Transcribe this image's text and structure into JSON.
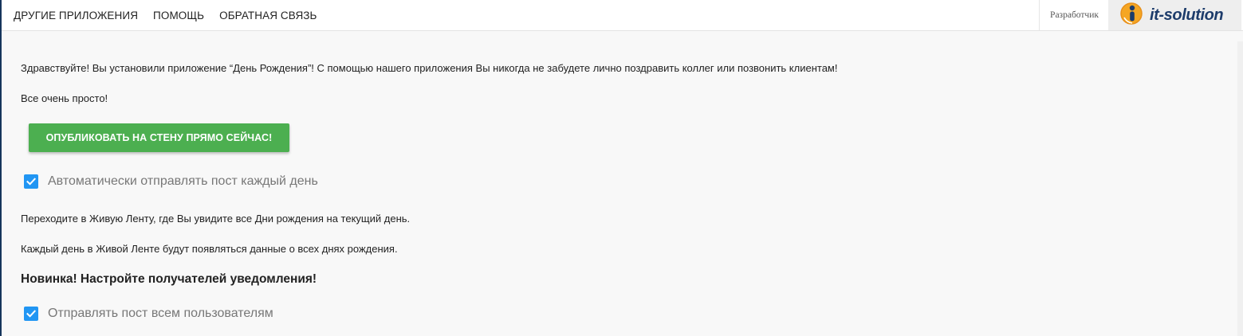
{
  "nav": {
    "items": [
      {
        "label": "ДРУГИЕ ПРИЛОЖЕНИЯ"
      },
      {
        "label": "ПОМОЩЬ"
      },
      {
        "label": "ОБРАТНАЯ СВЯЗЬ"
      }
    ]
  },
  "header": {
    "developer_label": "Разработчик",
    "brand_name": "it-solution",
    "brand_icon": "it-solution-logo-icon",
    "brand_color": "#1d3c6b",
    "logo_color": "#f5a623"
  },
  "main": {
    "intro_text": "Здравствуйте! Вы установили приложение “День Рождения”! С помощью нашего приложения Вы никогда не забудете лично поздравить коллег или позвонить клиентам!",
    "simple_text": "Все очень просто!",
    "publish_button": "ОПУБЛИКОВАТЬ НА СТЕНУ ПРЯМО СЕЙЧАС!",
    "auto_post": {
      "label": "Автоматически отправлять пост каждый день",
      "checked": true
    },
    "feed_text_1": "Переходите в Живую Ленту, где Вы увидите все Дни рождения на текущий день.",
    "feed_text_2": "Каждый день в Живой Ленте будут появляться данные о всех днях рождения.",
    "new_heading": "Новинка! Настройте получателей уведомления!",
    "send_all": {
      "label": "Отправлять пост всем пользователям",
      "checked": true
    }
  },
  "colors": {
    "accent_green": "#4caf50",
    "checkbox_blue": "#2196f3"
  }
}
